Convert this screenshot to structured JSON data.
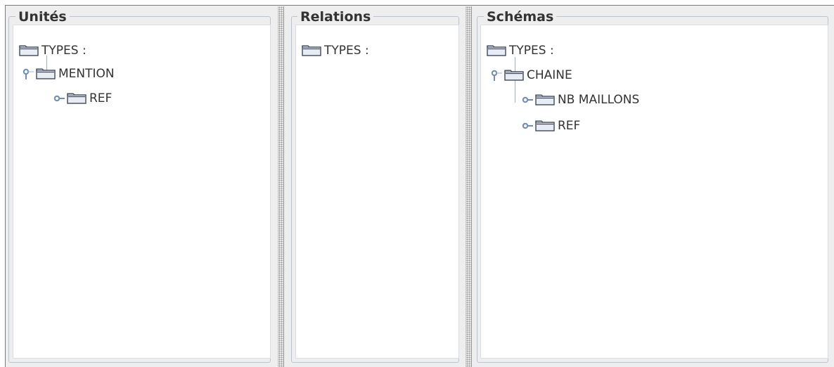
{
  "panels": [
    {
      "title": "Unités",
      "nodes": [
        {
          "label": "TYPES :"
        },
        {
          "label": "MENTION"
        },
        {
          "label": "REF"
        }
      ]
    },
    {
      "title": "Relations",
      "nodes": [
        {
          "label": "TYPES :"
        }
      ]
    },
    {
      "title": "Schémas",
      "nodes": [
        {
          "label": "TYPES :"
        },
        {
          "label": "CHAINE"
        },
        {
          "label": "NB MAILLONS"
        },
        {
          "label": "REF"
        }
      ]
    }
  ],
  "colors": {
    "tree_line": "#9fb0c8",
    "handle": "#6d8cc0",
    "folder_fill": "#e8edf5",
    "folder_border": "#40485a"
  },
  "icons": {
    "folder": "folder-icon",
    "expanded_handle": "expanded-handle-icon",
    "collapsed_handle": "collapsed-handle-icon"
  }
}
